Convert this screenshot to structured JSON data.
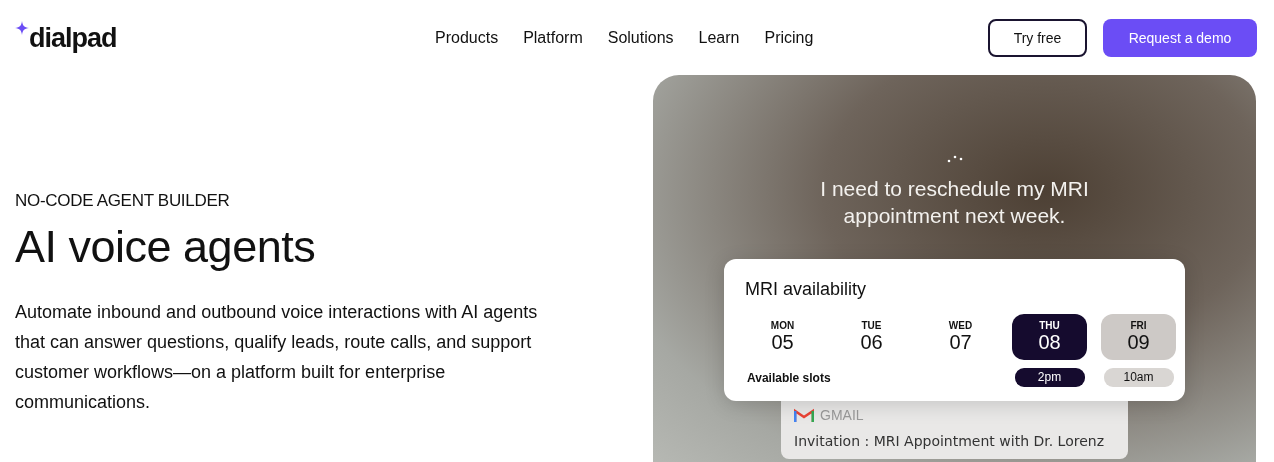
{
  "logo": {
    "text": "dialpad"
  },
  "nav": [
    "Products",
    "Platform",
    "Solutions",
    "Learn",
    "Pricing"
  ],
  "buttons": [
    {
      "label": "Try free",
      "kind": "outline"
    },
    {
      "label": "Request a demo",
      "kind": "primary"
    }
  ],
  "hero": {
    "eyebrow": "NO-CODE AGENT BUILDER",
    "title": "AI voice agents",
    "description": "Automate inbound and outbound voice interactions with AI agents that can answer questions, qualify leads, route calls, and support customer workflows—on a platform built for enterprise communications."
  },
  "showcase": {
    "caption": "I need to reschedule my MRI appointment next week.",
    "card": {
      "title": "MRI availability",
      "slots_label": "Available slots",
      "days": [
        {
          "weekday": "MON",
          "date": "05",
          "selected": false,
          "available": false
        },
        {
          "weekday": "TUE",
          "date": "06",
          "selected": false,
          "available": false
        },
        {
          "weekday": "WED",
          "date": "07",
          "selected": false,
          "available": false
        },
        {
          "weekday": "THU",
          "date": "08",
          "selected": true,
          "available": true,
          "slot": "2pm"
        },
        {
          "weekday": "FRI",
          "date": "09",
          "selected": false,
          "available": true,
          "slot": "10am"
        }
      ]
    },
    "email": {
      "source": "GMAIL",
      "subject": "Invitation : MRI Appointment with Dr. Lorenz"
    }
  }
}
